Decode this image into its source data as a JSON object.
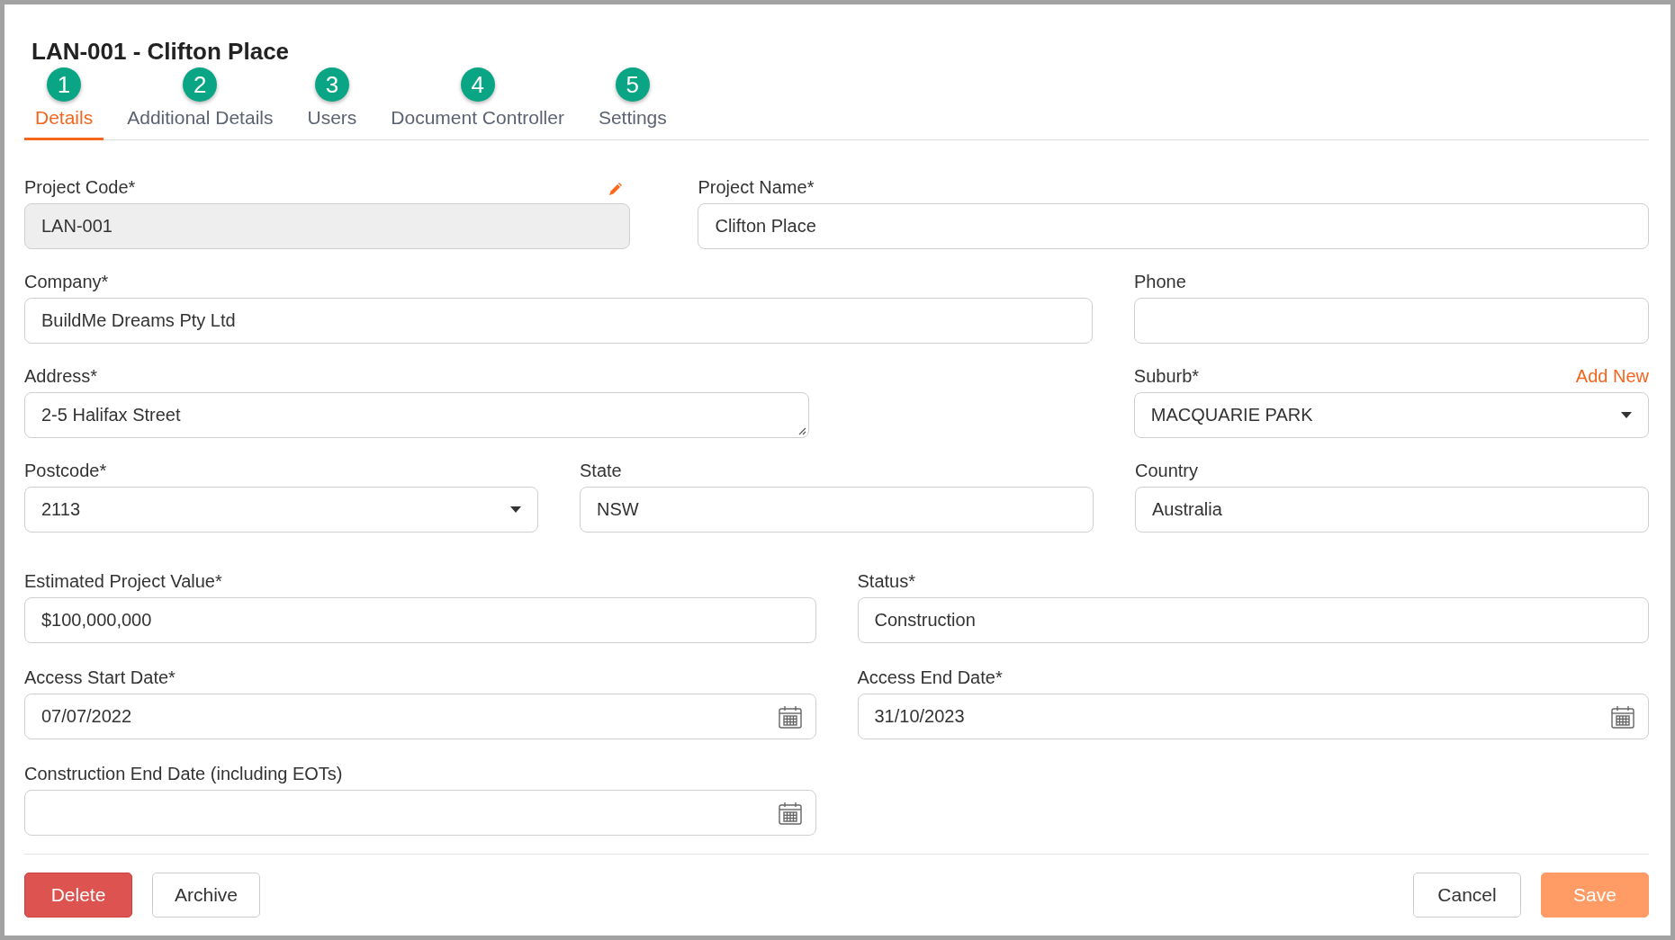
{
  "title": "LAN-001 - Clifton Place",
  "tabs": [
    {
      "number": "1",
      "label": "Details",
      "selected": true
    },
    {
      "number": "2",
      "label": "Additional Details",
      "selected": false
    },
    {
      "number": "3",
      "label": "Users",
      "selected": false
    },
    {
      "number": "4",
      "label": "Document Controller",
      "selected": false
    },
    {
      "number": "5",
      "label": "Settings",
      "selected": false
    }
  ],
  "rows": [
    [
      {
        "label": "Project Code*",
        "kind": "readonly",
        "value": "LAN-001",
        "label_action": {
          "kind": "edit"
        }
      },
      {
        "label": "Project Name*",
        "kind": "text",
        "value": "Clifton Place"
      }
    ],
    [
      {
        "label": "Company*",
        "kind": "text",
        "value": "BuildMe Dreams Pty Ltd"
      },
      {
        "label": "Phone",
        "kind": "text"
      }
    ],
    [
      {
        "label": "Address*",
        "kind": "textarea",
        "value": "2-5 Halifax Street"
      },
      {
        "label": "Suburb*",
        "kind": "select",
        "value": "MACQUARIE PARK",
        "label_action": {
          "kind": "link",
          "text": "Add New"
        }
      }
    ],
    [
      {
        "label": "Postcode*",
        "kind": "select",
        "value": "2113"
      },
      {
        "label": "State",
        "kind": "text",
        "value": "NSW"
      },
      {
        "label": "Country",
        "kind": "text",
        "value": "Australia"
      }
    ],
    [
      {
        "label": "Estimated Project Value*",
        "kind": "text",
        "value": "$100,000,000"
      },
      {
        "label": "Status*",
        "kind": "text",
        "value": "Construction"
      }
    ],
    [
      {
        "label": "Access Start Date*",
        "kind": "date",
        "value": "07/07/2022"
      },
      {
        "label": "Access End Date*",
        "kind": "date",
        "value": "31/10/2023"
      }
    ],
    [
      {
        "label": "Construction End Date (including EOTs)",
        "kind": "date"
      }
    ]
  ],
  "actions_left": [
    {
      "label": "Delete",
      "kind": "danger"
    },
    {
      "label": "Archive",
      "kind": "outline"
    }
  ],
  "actions_right": [
    {
      "label": "Cancel",
      "kind": "outline"
    },
    {
      "label": "Save",
      "kind": "primary"
    }
  ]
}
